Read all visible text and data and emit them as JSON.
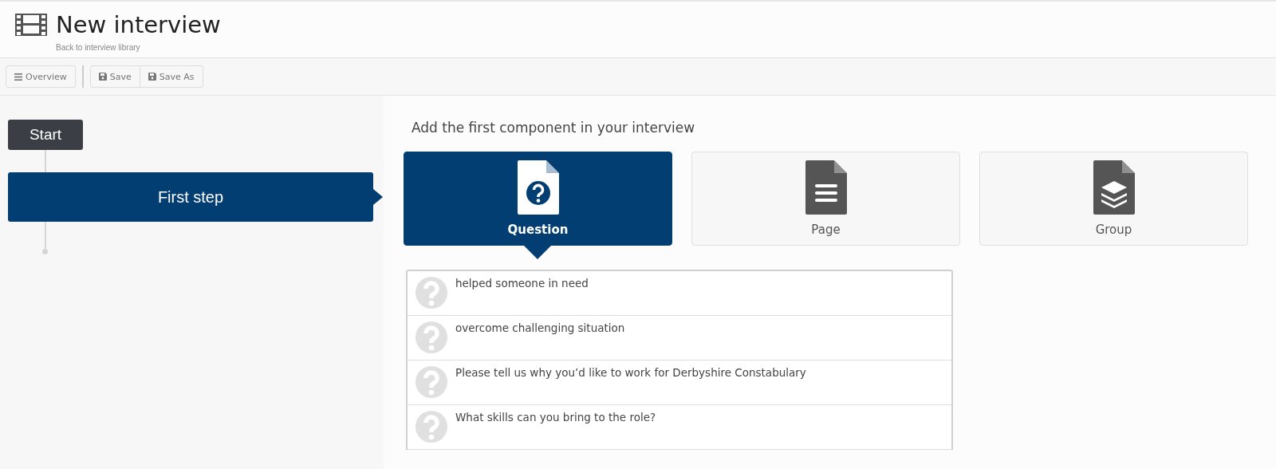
{
  "header": {
    "title": "New interview",
    "back_link": "Back to interview library"
  },
  "toolbar": {
    "buttons": [
      {
        "label": "Overview",
        "kind": "menu"
      },
      {
        "label": "Save",
        "kind": "save"
      },
      {
        "label": "Save As",
        "kind": "save"
      }
    ]
  },
  "flow": {
    "start": "Start",
    "steps": [
      {
        "label": "First step",
        "selected": true
      }
    ]
  },
  "prompt": "Add the first component in your interview",
  "components": [
    {
      "label": "Question",
      "kind": "question",
      "selected": true
    },
    {
      "label": "Page",
      "kind": "page",
      "selected": false
    },
    {
      "label": "Group",
      "kind": "group",
      "selected": false
    }
  ],
  "questions": [
    "helped someone in need",
    "overcome challenging situation",
    "Please tell us why you’d like to work for Derbyshire Constabulary",
    "What skills can you bring to the role?"
  ]
}
